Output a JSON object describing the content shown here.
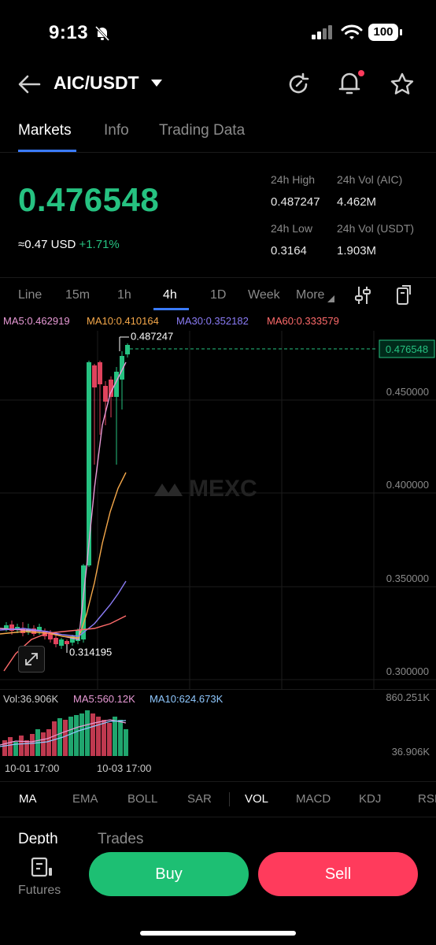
{
  "status": {
    "time": "9:13",
    "battery": "100"
  },
  "header": {
    "pair": "AIC/USDT"
  },
  "tabs": [
    {
      "label": "Markets"
    },
    {
      "label": "Info"
    },
    {
      "label": "Trading Data"
    }
  ],
  "ticker": {
    "price": "0.476548",
    "approx": "≈0.47",
    "currency": "USD",
    "change": "+1.71%",
    "high_label": "24h High",
    "high": "0.487247",
    "vol_aic_label": "24h Vol (AIC)",
    "vol_aic": "4.462M",
    "low_label": "24h Low",
    "low": "0.3164",
    "vol_usdt_label": "24h Vol  (USDT)",
    "vol_usdt": "1.903M"
  },
  "timeframes": [
    {
      "label": "Line"
    },
    {
      "label": "15m"
    },
    {
      "label": "1h"
    },
    {
      "label": "4h"
    },
    {
      "label": "1D"
    },
    {
      "label": "Week"
    },
    {
      "label": "More"
    }
  ],
  "ma": {
    "ma5": "MA5:0.462919",
    "ma10": "MA10:0.410164",
    "ma30": "MA30:0.352182",
    "ma60": "MA60:0.333579"
  },
  "chart": {
    "watermark": "MEXC",
    "high_marker": "0.487247",
    "low_marker": "0.314195",
    "last_price": "0.476548",
    "y_ticks": [
      "0.450000",
      "0.400000",
      "0.350000",
      "0.300000"
    ],
    "vol": {
      "vol": "Vol:36.906K",
      "ma5": "MA5:560.12K",
      "ma10": "MA10:624.673K",
      "top": "860.251K",
      "bottom": "36.906K"
    },
    "x_ticks": [
      "10-01 17:00",
      "10-03 17:00"
    ],
    "colors": {
      "up": "#26c281",
      "down": "#e0435d",
      "ma5": "#e89ad6",
      "ma10": "#f5a84a",
      "ma30": "#8b7cf6",
      "ma60": "#ff6b6b"
    }
  },
  "indicators": [
    {
      "label": "MA"
    },
    {
      "label": "EMA"
    },
    {
      "label": "BOLL"
    },
    {
      "label": "SAR"
    },
    {
      "label": "VOL"
    },
    {
      "label": "MACD"
    },
    {
      "label": "KDJ"
    },
    {
      "label": "RSI"
    }
  ],
  "bottom_tabs": [
    {
      "label": "Depth"
    },
    {
      "label": "Trades"
    }
  ],
  "footer": {
    "futures": "Futures",
    "buy": "Buy",
    "sell": "Sell"
  }
}
